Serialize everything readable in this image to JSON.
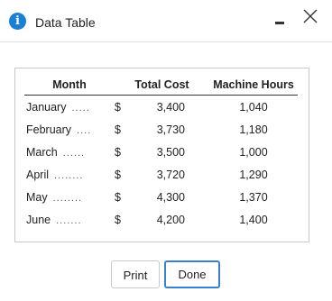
{
  "dialog": {
    "title": "Data Table",
    "icons": {
      "info": "info-icon",
      "minimize": "minimize-icon",
      "close": "close-icon"
    },
    "accent_color": "#1c7fd6"
  },
  "table": {
    "headers": {
      "month": "Month",
      "cost": "Total Cost",
      "hours": "Machine Hours"
    },
    "leaders": [
      ".....",
      "....",
      "......",
      "........",
      "........",
      "......."
    ],
    "rows": [
      {
        "month": "January",
        "currency": "$",
        "cost": "3,400",
        "hours": "1,040"
      },
      {
        "month": "February",
        "currency": "$",
        "cost": "3,730",
        "hours": "1,180"
      },
      {
        "month": "March",
        "currency": "$",
        "cost": "3,500",
        "hours": "1,000"
      },
      {
        "month": "April",
        "currency": "$",
        "cost": "3,720",
        "hours": "1,290"
      },
      {
        "month": "May",
        "currency": "$",
        "cost": "4,300",
        "hours": "1,370"
      },
      {
        "month": "June",
        "currency": "$",
        "cost": "4,200",
        "hours": "1,400"
      }
    ]
  },
  "buttons": {
    "print": "Print",
    "done": "Done",
    "done_border_color": "#3b7fd0"
  }
}
